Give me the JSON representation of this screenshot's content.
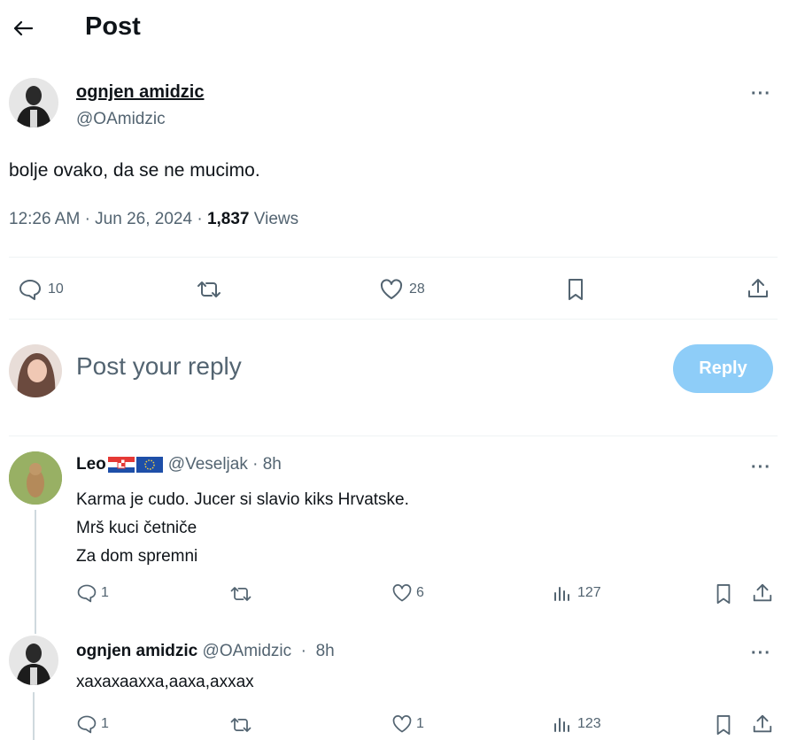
{
  "header": {
    "title": "Post"
  },
  "main_post": {
    "author_name": "ognjen amidzic",
    "author_handle": "@OAmidzic",
    "text": "bolje ovako, da se ne mucimo.",
    "time": "12:26 AM",
    "date": "Jun 26, 2024",
    "views_count": "1,837",
    "views_label": "Views",
    "replies": "10",
    "likes": "28"
  },
  "composer": {
    "placeholder": "Post your reply",
    "reply_label": "Reply"
  },
  "replies": [
    {
      "author_name": "Leo",
      "author_handle": "@Veseljak",
      "time": "8h",
      "lines": [
        "Karma je cudo. Jucer si slavio kiks Hrvatske.",
        "Mrš kuci četniče",
        "Za dom spremni"
      ],
      "replies": "1",
      "likes": "6",
      "views": "127"
    },
    {
      "author_name": "ognjen amidzic",
      "author_handle": "@OAmidzic",
      "time": "8h",
      "lines": [
        "хахахааxха,ааха,аxxах"
      ],
      "replies": "1",
      "likes": "1",
      "views": "123"
    }
  ],
  "colors": {
    "accent": "#1d9bf0",
    "reply_button_disabled": "#8ecdf8",
    "muted": "#536471"
  }
}
